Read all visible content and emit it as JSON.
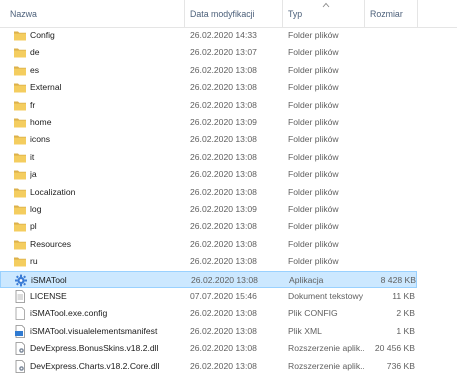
{
  "columns": {
    "name": "Nazwa",
    "date": "Data modyfikacji",
    "type": "Typ",
    "size": "Rozmiar"
  },
  "sort_indicator": "chevron-up-icon",
  "colors": {
    "folder": "#dcb14b",
    "selection_bg": "#cce8ff",
    "selection_border": "#99d1ff",
    "header_text": "#4c607a"
  },
  "rows": [
    {
      "name": "Config",
      "date": "26.02.2020 14:33",
      "type": "Folder plików",
      "size": "",
      "icon": "folder-icon"
    },
    {
      "name": "de",
      "date": "26.02.2020 13:07",
      "type": "Folder plików",
      "size": "",
      "icon": "folder-icon"
    },
    {
      "name": "es",
      "date": "26.02.2020 13:08",
      "type": "Folder plików",
      "size": "",
      "icon": "folder-icon"
    },
    {
      "name": "External",
      "date": "26.02.2020 13:08",
      "type": "Folder plików",
      "size": "",
      "icon": "folder-icon"
    },
    {
      "name": "fr",
      "date": "26.02.2020 13:08",
      "type": "Folder plików",
      "size": "",
      "icon": "folder-icon"
    },
    {
      "name": "home",
      "date": "26.02.2020 13:09",
      "type": "Folder plików",
      "size": "",
      "icon": "folder-icon"
    },
    {
      "name": "icons",
      "date": "26.02.2020 13:08",
      "type": "Folder plików",
      "size": "",
      "icon": "folder-icon"
    },
    {
      "name": "it",
      "date": "26.02.2020 13:08",
      "type": "Folder plików",
      "size": "",
      "icon": "folder-icon"
    },
    {
      "name": "ja",
      "date": "26.02.2020 13:08",
      "type": "Folder plików",
      "size": "",
      "icon": "folder-icon"
    },
    {
      "name": "Localization",
      "date": "26.02.2020 13:08",
      "type": "Folder plików",
      "size": "",
      "icon": "folder-icon"
    },
    {
      "name": "log",
      "date": "26.02.2020 13:09",
      "type": "Folder plików",
      "size": "",
      "icon": "folder-icon"
    },
    {
      "name": "pl",
      "date": "26.02.2020 13:08",
      "type": "Folder plików",
      "size": "",
      "icon": "folder-icon"
    },
    {
      "name": "Resources",
      "date": "26.02.2020 13:08",
      "type": "Folder plików",
      "size": "",
      "icon": "folder-icon"
    },
    {
      "name": "ru",
      "date": "26.02.2020 13:08",
      "type": "Folder plików",
      "size": "",
      "icon": "folder-icon"
    },
    {
      "name": "iSMATool",
      "date": "26.02.2020 13:08",
      "type": "Aplikacja",
      "size": "8 428 KB",
      "icon": "gear-app-icon",
      "selected": true
    },
    {
      "name": "LICENSE",
      "date": "07.07.2020 15:46",
      "type": "Dokument tekstowy",
      "size": "11 KB",
      "icon": "text-document-icon"
    },
    {
      "name": "iSMATool.exe.config",
      "date": "26.02.2020 13:08",
      "type": "Plik CONFIG",
      "size": "2 KB",
      "icon": "config-file-icon"
    },
    {
      "name": "iSMATool.visualelementsmanifest",
      "date": "26.02.2020 13:08",
      "type": "Plik XML",
      "size": "1 KB",
      "icon": "xml-file-icon"
    },
    {
      "name": "DevExpress.BonusSkins.v18.2.dll",
      "date": "26.02.2020 13:08",
      "type": "Rozszerzenie aplik...",
      "size": "20 456 KB",
      "icon": "dll-file-icon"
    },
    {
      "name": "DevExpress.Charts.v18.2.Core.dll",
      "date": "26.02.2020 13:08",
      "type": "Rozszerzenie aplik...",
      "size": "736 KB",
      "icon": "dll-file-icon"
    }
  ]
}
